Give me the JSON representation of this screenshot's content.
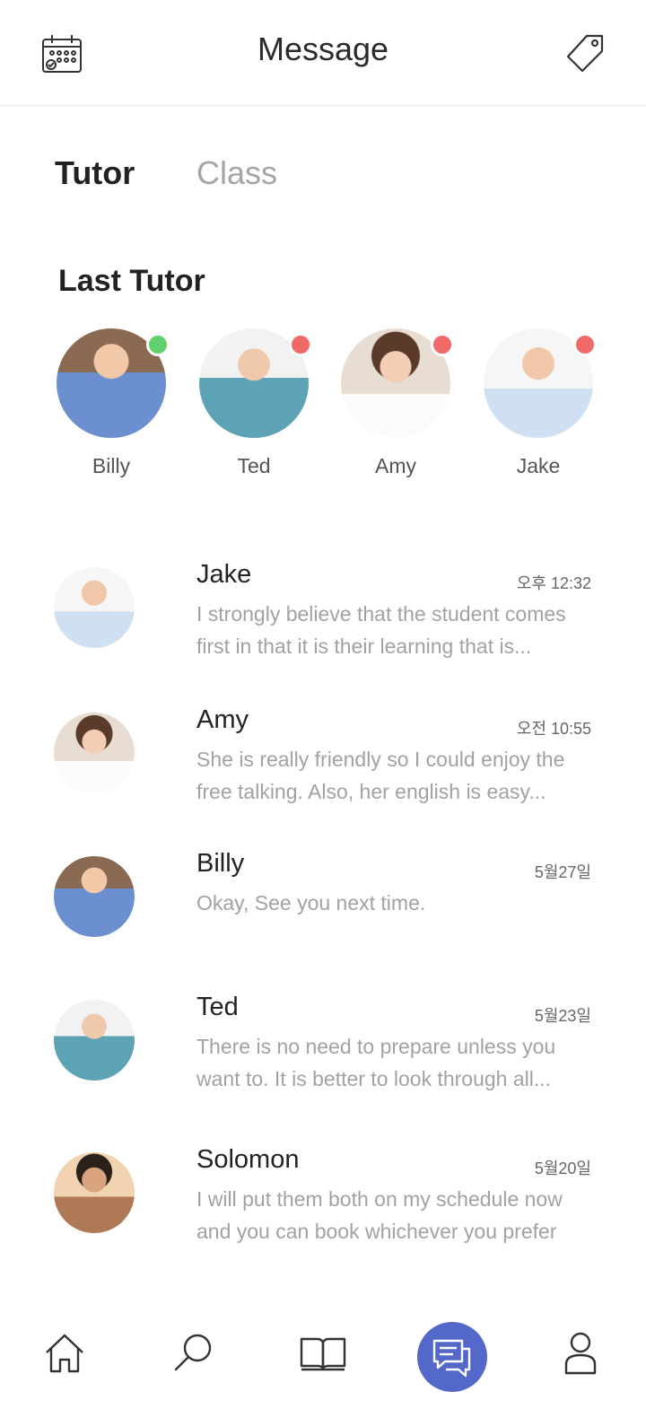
{
  "header": {
    "title": "Message",
    "left_icon": "calendar-icon",
    "right_icon": "tag-icon"
  },
  "tabs": [
    {
      "label": "Tutor",
      "active": true
    },
    {
      "label": "Class",
      "active": false
    }
  ],
  "last_tutor": {
    "title": "Last Tutor",
    "items": [
      {
        "name": "Billy",
        "status": "online",
        "status_color": "#5fd16f"
      },
      {
        "name": "Ted",
        "status": "offline",
        "status_color": "#f06a6a"
      },
      {
        "name": "Amy",
        "status": "offline",
        "status_color": "#f06a6a"
      },
      {
        "name": "Jake",
        "status": "offline",
        "status_color": "#f06a6a"
      }
    ]
  },
  "messages": [
    {
      "name": "Jake",
      "time": "오후 12:32",
      "preview": "I strongly believe that the student comes first in that it is their learning that is..."
    },
    {
      "name": "Amy",
      "time": "오전 10:55",
      "preview": "She is really friendly so I could enjoy the free talking. Also, her english is easy..."
    },
    {
      "name": "Billy",
      "time": "5월27일",
      "preview": "Okay, See you next time."
    },
    {
      "name": "Ted",
      "time": "5월23일",
      "preview": "There is no need to prepare unless you want to. It is better to look through all..."
    },
    {
      "name": "Solomon",
      "time": "5월20일",
      "preview": "I will put them both on my schedule now and you can book whichever you prefer"
    }
  ],
  "bottom_nav": [
    {
      "icon": "home-icon",
      "active": false
    },
    {
      "icon": "search-icon",
      "active": false
    },
    {
      "icon": "book-icon",
      "active": false
    },
    {
      "icon": "chat-icon",
      "active": true
    },
    {
      "icon": "profile-icon",
      "active": false
    }
  ],
  "colors": {
    "accent": "#5368c8",
    "online": "#5fd16f",
    "offline": "#f06a6a",
    "muted_text": "#a2a2a2"
  }
}
